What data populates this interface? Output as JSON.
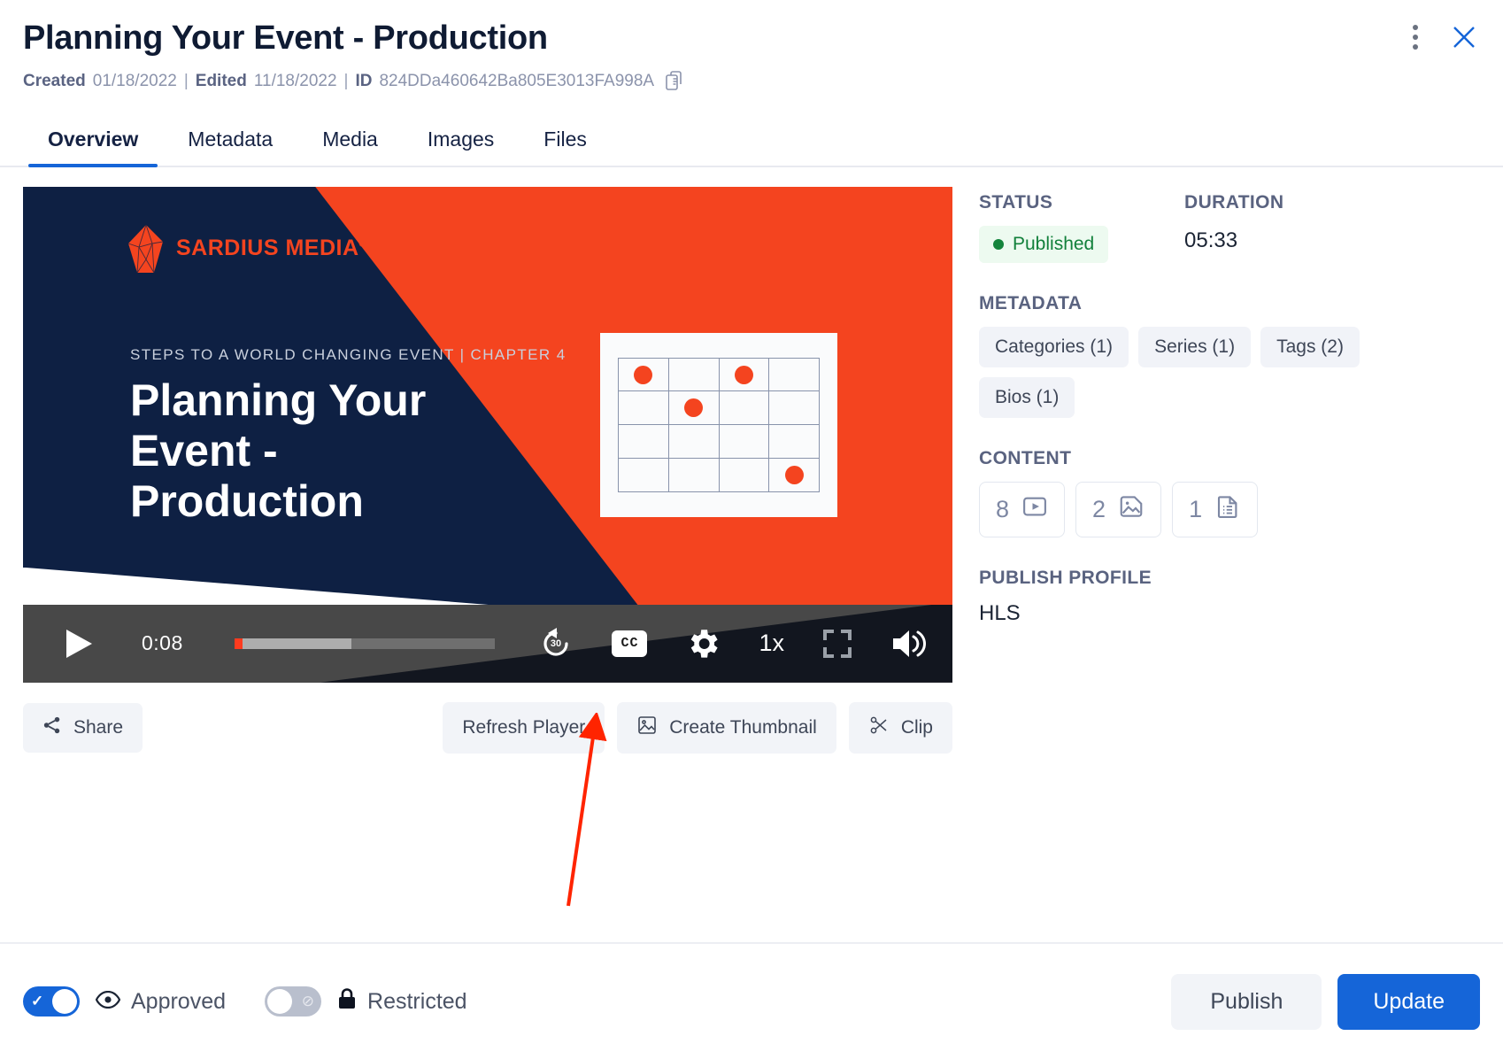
{
  "header": {
    "title": "Planning Your Event - Production",
    "created_label": "Created",
    "created_value": "01/18/2022",
    "edited_label": "Edited",
    "edited_value": "11/18/2022",
    "id_label": "ID",
    "id_value": "824DDa460642Ba805E3013FA998A",
    "sep": "|",
    "copy_icon": "copy-icon",
    "kebab_icon": "more-vertical-icon",
    "close_icon": "close-icon",
    "accent_blue": "#1565d8"
  },
  "tabs": [
    {
      "label": "Overview",
      "active": true
    },
    {
      "label": "Metadata",
      "active": false
    },
    {
      "label": "Media",
      "active": false
    },
    {
      "label": "Images",
      "active": false
    },
    {
      "label": "Files",
      "active": false
    }
  ],
  "slide": {
    "brand": "SARDIUS MEDIA",
    "brand_mark": "®",
    "eyebrow": "STEPS TO A WORLD CHANGING EVENT | CHAPTER 4",
    "title": "Planning Your Event - Production",
    "brand_color": "#f4441f",
    "bg_color": "#0e2043",
    "grid": {
      "rows": 4,
      "cols": 4,
      "dots": [
        [
          0,
          0
        ],
        [
          0,
          2
        ],
        [
          1,
          1
        ],
        [
          3,
          3
        ]
      ]
    }
  },
  "player": {
    "play_icon": "play-icon",
    "current_time": "0:08",
    "progress_percent": 3.3,
    "buffered_percent": 45,
    "rewind_icon": "rewind-30-icon",
    "rewind_label": "30",
    "cc_icon": "closed-captions-icon",
    "cc_label": "CC",
    "settings_icon": "gear-icon",
    "speed_label": "1x",
    "fullscreen_icon": "fullscreen-icon",
    "volume_icon": "volume-icon"
  },
  "player_actions": {
    "share": "Share",
    "share_icon": "share-icon",
    "refresh": "Refresh Player",
    "create_thumbnail": "Create Thumbnail",
    "thumbnail_icon": "image-icon",
    "clip": "Clip",
    "clip_icon": "scissors-icon"
  },
  "side": {
    "status_label": "STATUS",
    "status_value": "Published",
    "status_color": "#14843c",
    "duration_label": "DURATION",
    "duration_value": "05:33",
    "metadata_label": "METADATA",
    "metadata_chips": [
      "Categories (1)",
      "Series (1)",
      "Tags (2)",
      "Bios (1)"
    ],
    "content_label": "CONTENT",
    "content_items": [
      {
        "count": "8",
        "icon": "video-icon"
      },
      {
        "count": "2",
        "icon": "image-icon"
      },
      {
        "count": "1",
        "icon": "document-icon"
      }
    ],
    "publish_profile_label": "PUBLISH PROFILE",
    "publish_profile_value": "HLS"
  },
  "footer": {
    "approved_label": "Approved",
    "approved_icon": "eye-icon",
    "approved_on": true,
    "restricted_label": "Restricted",
    "restricted_icon": "lock-icon",
    "restricted_on": false,
    "publish_button": "Publish",
    "update_button": "Update"
  }
}
